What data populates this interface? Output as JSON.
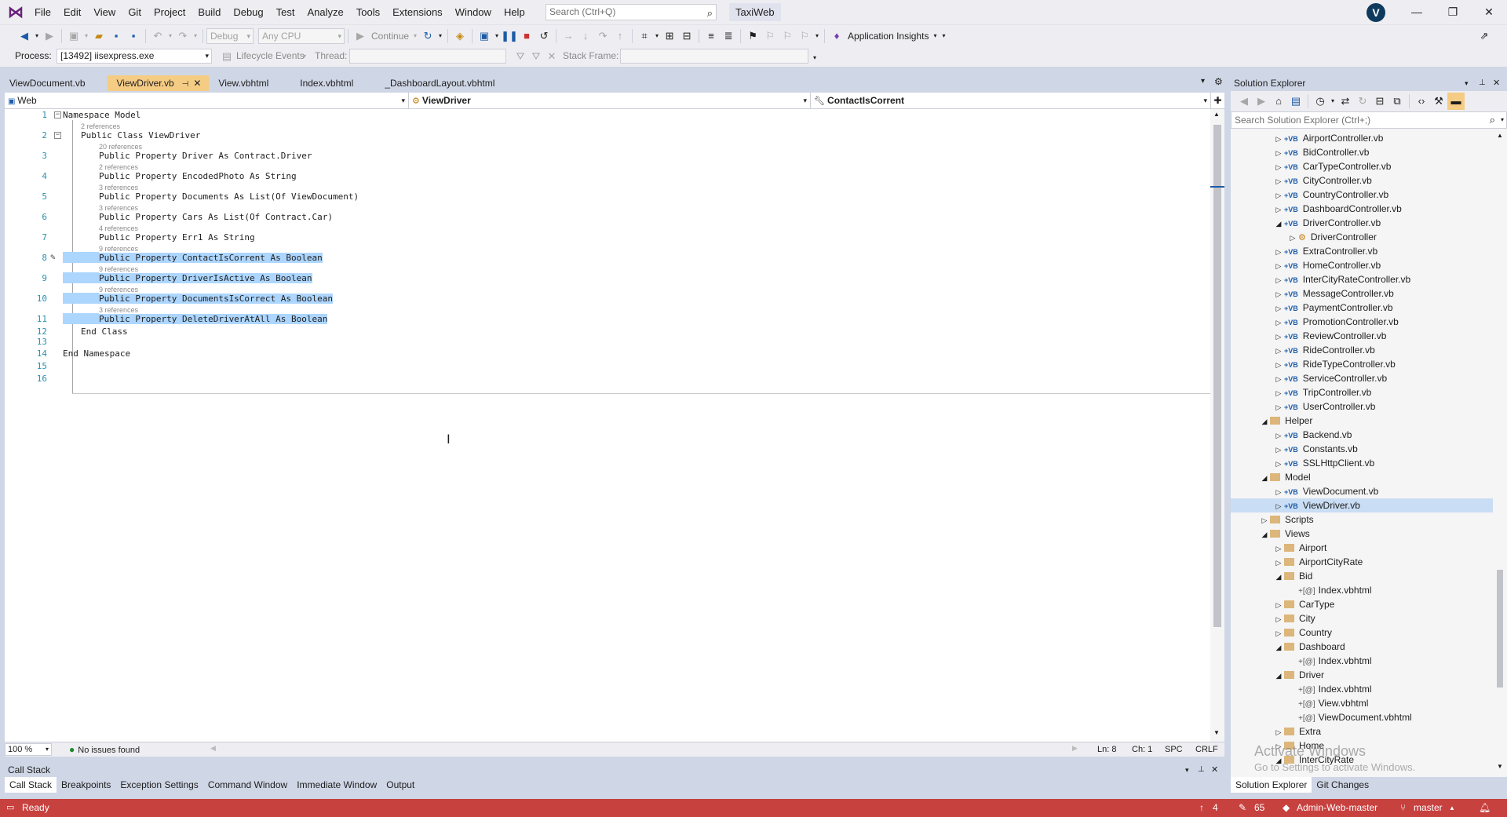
{
  "menu": [
    "File",
    "Edit",
    "View",
    "Git",
    "Project",
    "Build",
    "Debug",
    "Test",
    "Analyze",
    "Tools",
    "Extensions",
    "Window",
    "Help"
  ],
  "search": {
    "placeholder": "Search (Ctrl+Q)"
  },
  "solution_name": "TaxiWeb",
  "user_initial": "V",
  "toolbar": {
    "config": "Debug",
    "platform": "Any CPU",
    "continue_label": "Continue",
    "app_insights": "Application Insights"
  },
  "debug_toolbar": {
    "process_label": "Process:",
    "process_value": "[13492] iisexpress.exe",
    "lifecycle_label": "Lifecycle Events",
    "thread_label": "Thread:",
    "stack_frame_label": "Stack Frame:"
  },
  "tabs": [
    {
      "label": "ViewDocument.vb",
      "active": false
    },
    {
      "label": "ViewDriver.vb",
      "active": true
    },
    {
      "label": "View.vbhtml",
      "active": false
    },
    {
      "label": "Index.vbhtml",
      "active": false
    },
    {
      "label": "_DashboardLayout.vbhtml",
      "active": false
    }
  ],
  "navbar": {
    "project": "Web",
    "type": "ViewDriver",
    "member": "ContactIsCorrent"
  },
  "code": {
    "lines": [
      {
        "n": "1",
        "text": "Namespace Model"
      },
      {
        "n": "2",
        "refs": "2 references",
        "text": "Public Class ViewDriver"
      },
      {
        "n": "3",
        "refs": "20 references",
        "text": "Public Property Driver As Contract.Driver"
      },
      {
        "n": "4",
        "refs": "2 references",
        "text": "Public Property EncodedPhoto As String"
      },
      {
        "n": "5",
        "refs": "3 references",
        "text": "Public Property Documents As List(Of ViewDocument)"
      },
      {
        "n": "6",
        "refs": "3 references",
        "text": "Public Property Cars As List(Of Contract.Car)"
      },
      {
        "n": "7",
        "refs": "4 references",
        "text": "Public Property Err1 As String"
      },
      {
        "n": "8",
        "refs": "9 references",
        "text": "Public Property ContactIsCorrent As Boolean"
      },
      {
        "n": "9",
        "refs": "9 references",
        "text": "Public Property DriverIsActive As Boolean"
      },
      {
        "n": "10",
        "refs": "9 references",
        "text": "Public Property DocumentsIsCorrect As Boolean"
      },
      {
        "n": "11",
        "refs": "3 references",
        "text": "Public Property DeleteDriverAtAll As Boolean"
      },
      {
        "n": "12",
        "text": "End Class"
      },
      {
        "n": "13",
        "text": ""
      },
      {
        "n": "14",
        "text": "End Namespace"
      },
      {
        "n": "15",
        "text": ""
      },
      {
        "n": "16",
        "text": ""
      }
    ]
  },
  "editor_status": {
    "zoom": "100 %",
    "issues": "No issues found",
    "line": "Ln: 8",
    "col": "Ch: 1",
    "spc": "SPC",
    "eol": "CRLF"
  },
  "bottom_panel": {
    "title": "Call Stack",
    "tabs": [
      "Call Stack",
      "Breakpoints",
      "Exception Settings",
      "Command Window",
      "Immediate Window",
      "Output"
    ]
  },
  "solution_explorer": {
    "title": "Solution Explorer",
    "search_placeholder": "Search Solution Explorer (Ctrl+;)",
    "tabs": [
      "Solution Explorer",
      "Git Changes"
    ],
    "watermark_1": "Activate Windows",
    "watermark_2": "Go to Settings to activate Windows.",
    "items": [
      {
        "label": "AirportController.vb",
        "kind": "vb",
        "depth": 2,
        "exp": "right"
      },
      {
        "label": "BidController.vb",
        "kind": "vb",
        "depth": 2,
        "exp": "right"
      },
      {
        "label": "CarTypeController.vb",
        "kind": "vb",
        "depth": 2,
        "exp": "right"
      },
      {
        "label": "CityController.vb",
        "kind": "vb",
        "depth": 2,
        "exp": "right"
      },
      {
        "label": "CountryController.vb",
        "kind": "vb",
        "depth": 2,
        "exp": "right"
      },
      {
        "label": "DashboardController.vb",
        "kind": "vb",
        "depth": 2,
        "exp": "right"
      },
      {
        "label": "DriverController.vb",
        "kind": "vb",
        "depth": 2,
        "exp": "down"
      },
      {
        "label": "DriverController",
        "kind": "class",
        "depth": 3,
        "exp": "right"
      },
      {
        "label": "ExtraController.vb",
        "kind": "vb",
        "depth": 2,
        "exp": "right"
      },
      {
        "label": "HomeController.vb",
        "kind": "vb",
        "depth": 2,
        "exp": "right"
      },
      {
        "label": "InterCityRateController.vb",
        "kind": "vb",
        "depth": 2,
        "exp": "right"
      },
      {
        "label": "MessageController.vb",
        "kind": "vb",
        "depth": 2,
        "exp": "right"
      },
      {
        "label": "PaymentController.vb",
        "kind": "vb",
        "depth": 2,
        "exp": "right"
      },
      {
        "label": "PromotionController.vb",
        "kind": "vb",
        "depth": 2,
        "exp": "right"
      },
      {
        "label": "ReviewController.vb",
        "kind": "vb",
        "depth": 2,
        "exp": "right"
      },
      {
        "label": "RideController.vb",
        "kind": "vb",
        "depth": 2,
        "exp": "right"
      },
      {
        "label": "RideTypeController.vb",
        "kind": "vb",
        "depth": 2,
        "exp": "right"
      },
      {
        "label": "ServiceController.vb",
        "kind": "vb",
        "depth": 2,
        "exp": "right"
      },
      {
        "label": "TripController.vb",
        "kind": "vb",
        "depth": 2,
        "exp": "right"
      },
      {
        "label": "UserController.vb",
        "kind": "vb",
        "depth": 2,
        "exp": "right"
      },
      {
        "label": "Helper",
        "kind": "folder",
        "depth": 1,
        "exp": "down"
      },
      {
        "label": "Backend.vb",
        "kind": "vb",
        "depth": 2,
        "exp": "right"
      },
      {
        "label": "Constants.vb",
        "kind": "vb",
        "depth": 2,
        "exp": "right"
      },
      {
        "label": "SSLHttpClient.vb",
        "kind": "vb",
        "depth": 2,
        "exp": "right"
      },
      {
        "label": "Model",
        "kind": "folder",
        "depth": 1,
        "exp": "down"
      },
      {
        "label": "ViewDocument.vb",
        "kind": "vb",
        "depth": 2,
        "exp": "right"
      },
      {
        "label": "ViewDriver.vb",
        "kind": "vb",
        "depth": 2,
        "exp": "right",
        "selected": true
      },
      {
        "label": "Scripts",
        "kind": "folder",
        "depth": 1,
        "exp": "right"
      },
      {
        "label": "Views",
        "kind": "folder",
        "depth": 1,
        "exp": "down"
      },
      {
        "label": "Airport",
        "kind": "folder",
        "depth": 2,
        "exp": "right"
      },
      {
        "label": "AirportCityRate",
        "kind": "folder",
        "depth": 2,
        "exp": "right"
      },
      {
        "label": "Bid",
        "kind": "folder",
        "depth": 2,
        "exp": "down"
      },
      {
        "label": "Index.vbhtml",
        "kind": "html",
        "depth": 3,
        "exp": ""
      },
      {
        "label": "CarType",
        "kind": "folder",
        "depth": 2,
        "exp": "right"
      },
      {
        "label": "City",
        "kind": "folder",
        "depth": 2,
        "exp": "right"
      },
      {
        "label": "Country",
        "kind": "folder",
        "depth": 2,
        "exp": "right"
      },
      {
        "label": "Dashboard",
        "kind": "folder",
        "depth": 2,
        "exp": "down"
      },
      {
        "label": "Index.vbhtml",
        "kind": "html",
        "depth": 3,
        "exp": ""
      },
      {
        "label": "Driver",
        "kind": "folder",
        "depth": 2,
        "exp": "down"
      },
      {
        "label": "Index.vbhtml",
        "kind": "html",
        "depth": 3,
        "exp": ""
      },
      {
        "label": "View.vbhtml",
        "kind": "html",
        "depth": 3,
        "exp": ""
      },
      {
        "label": "ViewDocument.vbhtml",
        "kind": "html",
        "depth": 3,
        "exp": ""
      },
      {
        "label": "Extra",
        "kind": "folder",
        "depth": 2,
        "exp": "right"
      },
      {
        "label": "Home",
        "kind": "folder",
        "depth": 2,
        "exp": "right"
      },
      {
        "label": "InterCityRate",
        "kind": "folder",
        "depth": 2,
        "exp": "down"
      }
    ]
  },
  "statusbar": {
    "ready": "Ready",
    "up_count": "4",
    "pencil_count": "65",
    "repo": "Admin-Web-master",
    "branch": "master"
  },
  "colors": {
    "statusbar_bg": "#c7413f",
    "active_tab": "#f5cc84",
    "selection": "#add6ff",
    "keyword": "#0000ff",
    "type": "#2b91af"
  }
}
